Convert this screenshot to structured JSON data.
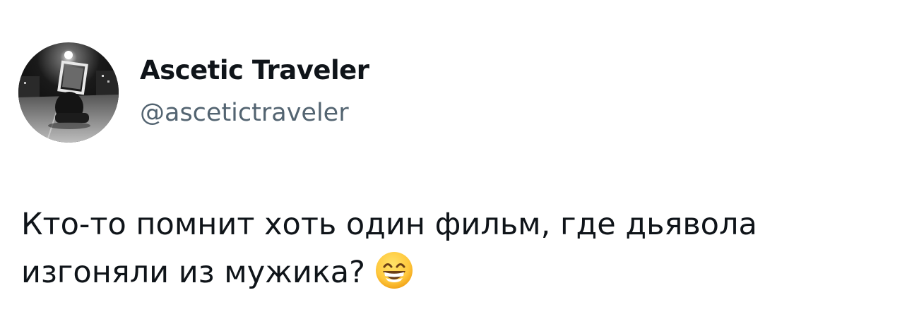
{
  "author": {
    "display_name": "Ascetic Traveler",
    "handle": "@ascetictraveler",
    "avatar_icon": "profile-photo"
  },
  "tweet": {
    "line1": "Кто-то помнит хоть один фильм, где дьявола",
    "line2": "изгоняли из мужика?",
    "emoji": "grinning-face-with-smiling-eyes-icon"
  },
  "colors": {
    "text_primary": "#0f1419",
    "text_secondary": "#536471",
    "background": "#ffffff"
  }
}
